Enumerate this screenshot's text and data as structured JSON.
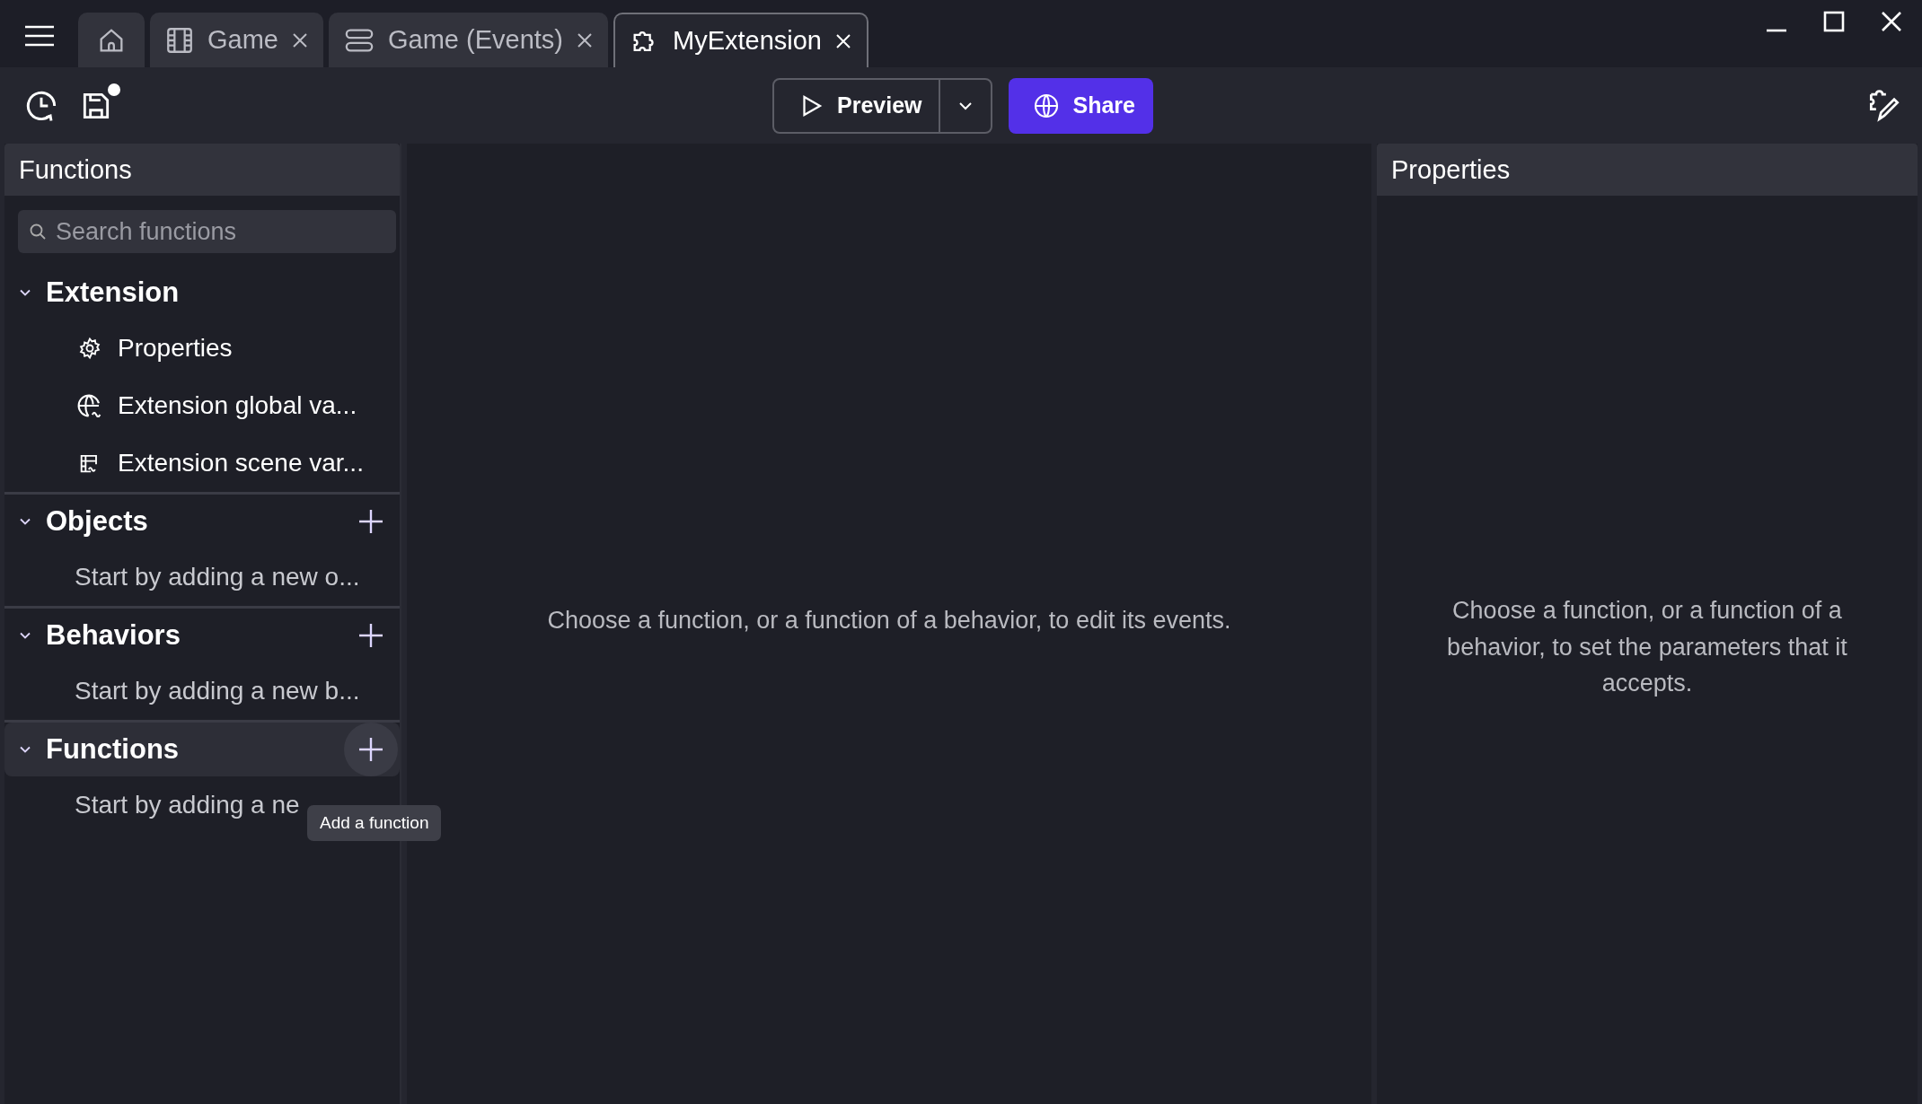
{
  "tabs": [
    {
      "kind": "home",
      "selected": false
    },
    {
      "kind": "scene",
      "label": "Game",
      "selected": false
    },
    {
      "kind": "events",
      "label": "Game (Events)",
      "selected": false
    },
    {
      "kind": "extension",
      "label": "MyExtension",
      "selected": true
    }
  ],
  "toolbar": {
    "save_unsaved": true,
    "preview": "Preview",
    "share": "Share"
  },
  "functions_panel": {
    "title": "Functions",
    "search": {
      "placeholder": "Search functions"
    },
    "sections": [
      {
        "title": "Extension",
        "expanded": true,
        "addable": false,
        "highlighted": false,
        "items": [
          {
            "kind": "gear",
            "label": "Properties"
          },
          {
            "kind": "globe",
            "label": "Extension global va..."
          },
          {
            "kind": "scene",
            "label": "Extension scene var..."
          }
        ]
      },
      {
        "title": "Objects",
        "expanded": true,
        "addable": true,
        "highlighted": false,
        "empty_text": "Start by adding a new o..."
      },
      {
        "title": "Behaviors",
        "expanded": true,
        "addable": true,
        "highlighted": false,
        "empty_text": "Start by adding a new b..."
      },
      {
        "title": "Functions",
        "expanded": true,
        "addable": true,
        "highlighted": true,
        "empty_text": "Start by adding a ne",
        "tooltip": "Add a function"
      }
    ]
  },
  "editor": {
    "message": "Choose a function, or a function of a behavior, to edit its events."
  },
  "properties_panel": {
    "title": "Properties",
    "message": "Choose a function, or a function of a behavior, to set the parameters that it accepts."
  }
}
